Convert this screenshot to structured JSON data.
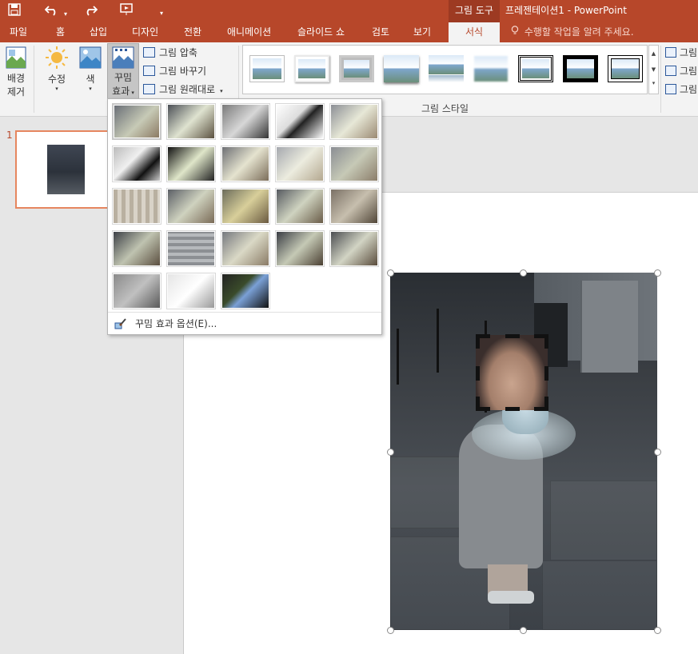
{
  "titlebar": {
    "context_tool": "그림 도구",
    "document_title": "프레젠테이션1 - PowerPoint",
    "quick_access": {
      "save_icon": "save-icon",
      "undo_icon": "undo-icon",
      "redo_icon": "redo-icon",
      "present_icon": "present-from-beginning-icon",
      "customize_icon": "customize-qat-icon"
    }
  },
  "tabs": [
    "파일",
    "홈",
    "삽입",
    "디자인",
    "전환",
    "애니메이션",
    "슬라이드 쇼",
    "검토",
    "보기"
  ],
  "active_tab": "서식",
  "tell_me": "수행할 작업을 알려 주세요.",
  "ribbon": {
    "remove_bg": "배경\n제거",
    "remove_bg_l1": "배경",
    "remove_bg_l2": "제거",
    "corrections": "수정",
    "color": "색",
    "artistic_l1": "꾸밈",
    "artistic_l2": "효과",
    "compress": "그림 압축",
    "change": "그림 바꾸기",
    "reset": "그림 원래대로",
    "styles_group_label": "그림 스타일",
    "right_items": [
      "그림",
      "그림",
      "그림"
    ]
  },
  "slides_pane": {
    "slide_number": "1"
  },
  "artistic_effects": {
    "rows": 5,
    "items_count": 23,
    "options_label": "꾸밈 효과 옵션(E)..."
  },
  "colors": {
    "accent": "#b7472a",
    "accent_dark": "#9d3a22",
    "selected_thumb_border": "#e6865f"
  }
}
